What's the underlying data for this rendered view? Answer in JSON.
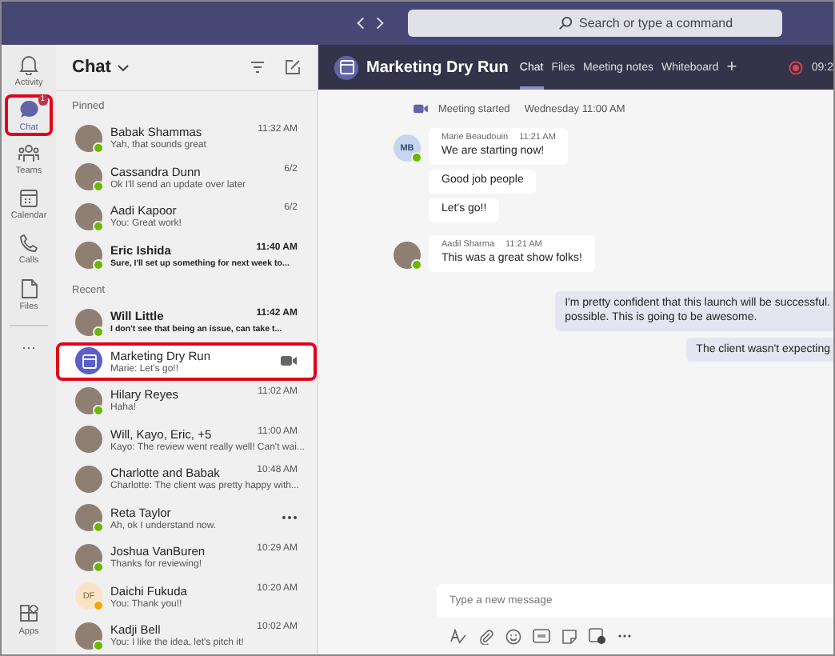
{
  "top_bar": {
    "search": {
      "placeholder": "Search or type a command"
    }
  },
  "rail": {
    "items": [
      {
        "label": "Activity",
        "selected": false,
        "highlighted": false
      },
      {
        "label": "Chat",
        "selected": true,
        "highlighted": true,
        "badge": "1"
      },
      {
        "label": "Teams",
        "selected": false,
        "highlighted": false
      },
      {
        "label": "Calendar",
        "selected": false,
        "highlighted": false
      },
      {
        "label": "Calls",
        "selected": false,
        "highlighted": false
      },
      {
        "label": "Files",
        "selected": false,
        "highlighted": false
      }
    ],
    "more": "···",
    "apps": {
      "label": "Apps"
    }
  },
  "chat_list": {
    "title": "Chat",
    "sections": [
      {
        "title": "Pinned",
        "items": [
          {
            "kind": "photo",
            "name": "Babak Shammas",
            "time": "11:32 AM",
            "preview": "Yah, that sounds great",
            "color": "#6bb700",
            "unread": false,
            "selected": false,
            "highlighted": false,
            "in_call": false,
            "hovered": false
          },
          {
            "kind": "photo",
            "name": "Cassandra Dunn",
            "time": "6/2",
            "preview": "Ok I'll send an update over later",
            "color": "#6bb700",
            "unread": false,
            "selected": false,
            "highlighted": false,
            "in_call": false,
            "hovered": false
          },
          {
            "kind": "photo",
            "name": "Aadi Kapoor",
            "time": "6/2",
            "preview": "You: Great work!",
            "color": "#6bb700",
            "unread": false,
            "selected": false,
            "highlighted": false,
            "in_call": false,
            "hovered": false
          },
          {
            "kind": "photo",
            "name": "Eric Ishida",
            "time": "11:40 AM",
            "preview": "Sure, I'll set up something for next week to...",
            "color": "#6bb700",
            "unread": true,
            "selected": false,
            "highlighted": false,
            "in_call": false,
            "hovered": false
          }
        ]
      },
      {
        "title": "Recent",
        "items": [
          {
            "kind": "photo",
            "name": "Will Little",
            "time": "11:42 AM",
            "preview": "I don't see that being an issue, can take t...",
            "color": "#6bb700",
            "unread": true,
            "selected": false,
            "highlighted": false,
            "in_call": false,
            "hovered": false
          },
          {
            "kind": "meeting",
            "name": "Marketing Dry Run",
            "preview": "Marie: Let's go!!",
            "unread": false,
            "selected": true,
            "highlighted": true,
            "in_call": true,
            "hovered": false
          },
          {
            "kind": "photo",
            "name": "Hilary Reyes",
            "time": "11:02 AM",
            "preview": "Haha!",
            "color": "#6bb700",
            "unread": false,
            "selected": false,
            "highlighted": false,
            "in_call": false,
            "hovered": false
          },
          {
            "kind": "photo",
            "name": "Will, Kayo, Eric, +5",
            "time": "11:00 AM",
            "preview": "Kayo: The review went really well! Can't wai...",
            "unread": false,
            "selected": false,
            "highlighted": false,
            "in_call": false,
            "hovered": false
          },
          {
            "kind": "photo",
            "name": "Charlotte and Babak",
            "time": "10:48 AM",
            "preview": "Charlotte: The client was pretty happy with...",
            "unread": false,
            "selected": false,
            "highlighted": false,
            "in_call": false,
            "hovered": false
          },
          {
            "kind": "photo",
            "name": "Reta Taylor",
            "preview": "Ah, ok I understand now.",
            "color": "#6bb700",
            "unread": false,
            "selected": false,
            "highlighted": false,
            "in_call": false,
            "hovered": true
          },
          {
            "kind": "photo",
            "name": "Joshua VanBuren",
            "time": "10:29 AM",
            "preview": "Thanks for reviewing!",
            "color": "#6bb700",
            "unread": false,
            "selected": false,
            "highlighted": false,
            "in_call": false,
            "hovered": false
          },
          {
            "kind": "initials",
            "name": "Daichi Fukuda",
            "initials": "DF",
            "time": "10:20 AM",
            "preview": "You: Thank you!!",
            "color": "#f8a30a",
            "unread": false,
            "selected": false,
            "highlighted": false,
            "in_call": false,
            "hovered": false
          },
          {
            "kind": "photo",
            "name": "Kadji Bell",
            "time": "10:02 AM",
            "preview": "You: I like the idea, let's pitch it!",
            "color": "#6bb700",
            "unread": false,
            "selected": false,
            "highlighted": false,
            "in_call": false,
            "hovered": false
          }
        ]
      }
    ]
  },
  "conversation": {
    "title": "Marketing Dry Run",
    "tabs": [
      {
        "label": "Chat",
        "selected": true
      },
      {
        "label": "Files",
        "selected": false
      },
      {
        "label": "Meeting notes",
        "selected": false
      },
      {
        "label": "Whiteboard",
        "selected": false
      }
    ],
    "add_tab": "+",
    "recording_time": "09:2",
    "event": {
      "text": "Meeting started",
      "time": "Wednesday 11:00 AM"
    },
    "messages": [
      {
        "kind": "other",
        "sender": "Marie Beaudouin",
        "time": "11:21 AM",
        "initials": "MB",
        "color": "#6bb700",
        "bubbles": [
          "We are starting now!",
          "Good job people",
          "Let's go!!"
        ]
      },
      {
        "kind": "other",
        "sender": "Aadil Sharma",
        "time": "11:21 AM",
        "color": "#6bb700",
        "bubbles": [
          "This was a great show folks!"
        ]
      },
      {
        "kind": "me",
        "bubbles": [
          "I'm pretty confident that this launch will be successful.\npossible. This is going to be awesome.",
          "The client wasn't expecting"
        ]
      }
    ],
    "composer": {
      "placeholder": "Type a new message"
    }
  }
}
